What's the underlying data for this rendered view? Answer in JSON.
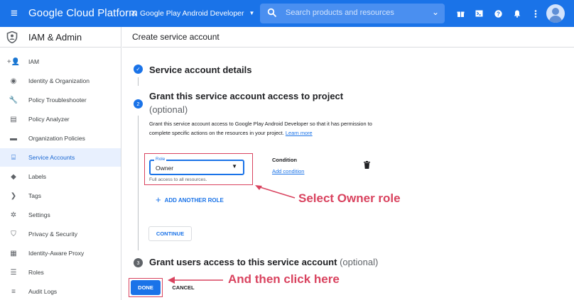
{
  "topbar": {
    "brand": "Google Cloud Platform",
    "project": "Google Play Android Developer",
    "search_placeholder": "Search products and resources"
  },
  "sidebar": {
    "title": "IAM & Admin",
    "items": [
      {
        "label": "IAM",
        "icon": "person-add-icon",
        "glyph": "+👤"
      },
      {
        "label": "Identity & Organization",
        "icon": "account-circle-icon",
        "glyph": "◉"
      },
      {
        "label": "Policy Troubleshooter",
        "icon": "wrench-icon",
        "glyph": "🔧"
      },
      {
        "label": "Policy Analyzer",
        "icon": "document-search-icon",
        "glyph": "▤"
      },
      {
        "label": "Organization Policies",
        "icon": "list-box-icon",
        "glyph": "▬"
      },
      {
        "label": "Service Accounts",
        "icon": "service-account-icon",
        "glyph": "⌸"
      },
      {
        "label": "Labels",
        "icon": "tag-icon",
        "glyph": "◆"
      },
      {
        "label": "Tags",
        "icon": "chevron-tag-icon",
        "glyph": "❯"
      },
      {
        "label": "Settings",
        "icon": "gear-icon",
        "glyph": "✲"
      },
      {
        "label": "Privacy & Security",
        "icon": "shield-icon",
        "glyph": "⛉"
      },
      {
        "label": "Identity-Aware Proxy",
        "icon": "proxy-grid-icon",
        "glyph": "▦"
      },
      {
        "label": "Roles",
        "icon": "roles-stack-icon",
        "glyph": "☰"
      },
      {
        "label": "Audit Logs",
        "icon": "lines-icon",
        "glyph": "≡"
      }
    ]
  },
  "main": {
    "page_title": "Create service account",
    "step1": {
      "title": "Service account details"
    },
    "step2": {
      "number": "2",
      "title": "Grant this service account access to project",
      "optional": "(optional)",
      "description": "Grant this service account access to Google Play Android Developer so that it has permission to complete specific actions on the resources in your project.",
      "learn_more": "Learn more",
      "role_label": "Role",
      "role_value": "Owner",
      "role_hint": "Full access to all resources.",
      "condition_label": "Condition",
      "add_condition": "Add condition",
      "add_another_role": "ADD ANOTHER ROLE",
      "continue": "CONTINUE"
    },
    "step3": {
      "number": "3",
      "title": "Grant users access to this service account",
      "optional": "(optional)"
    },
    "done": "DONE",
    "cancel": "CANCEL"
  },
  "annotations": {
    "select_owner": "Select Owner role",
    "click_here": "And then click here",
    "color": "#d9435f"
  },
  "colors": {
    "topbar": "#1a73e8",
    "accent": "#1a73e8",
    "active_bg": "#e8f0fe"
  }
}
